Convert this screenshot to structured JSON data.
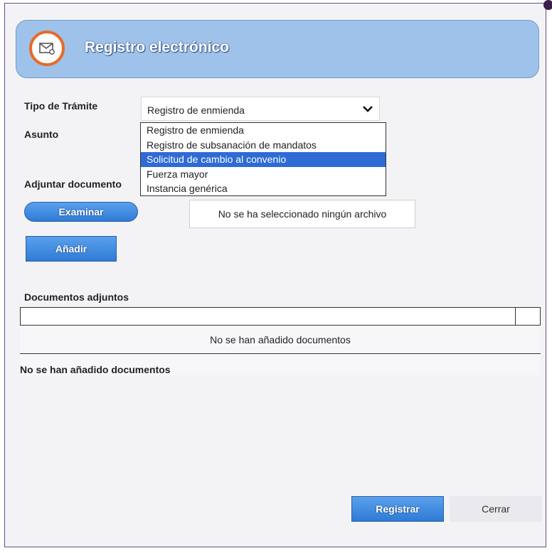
{
  "header": {
    "title": "Registro electrónico",
    "icon": "mail-certificate-icon"
  },
  "form": {
    "tipo_label": "Tipo de Trámite",
    "tipo_value": "Registro de enmienda",
    "asunto_label": "Asunto",
    "adjuntar_label": "Adjuntar documento",
    "dropdown_options": [
      "Registro de enmienda",
      "Registro de subsanación de mandatos",
      "Solicitud de cambio al convenio",
      "Fuerza mayor",
      "Instancia genérica"
    ],
    "selected_option_index": 2,
    "examinar_label": "Examinar",
    "file_status": "No se ha seleccionado ningún archivo",
    "anadir_label": "Añadir"
  },
  "documents": {
    "title": "Documentos adjuntos",
    "table_empty": "No se han añadido documentos",
    "footer_empty": "No se han añadido documentos"
  },
  "actions": {
    "registrar_label": "Registrar",
    "cerrar_label": "Cerrar"
  },
  "colors": {
    "header_bg": "#9fc2ea",
    "accent_blue": "#2f7bd6",
    "icon_ring": "#e86a2a",
    "selected_option": "#2e6bd4"
  }
}
